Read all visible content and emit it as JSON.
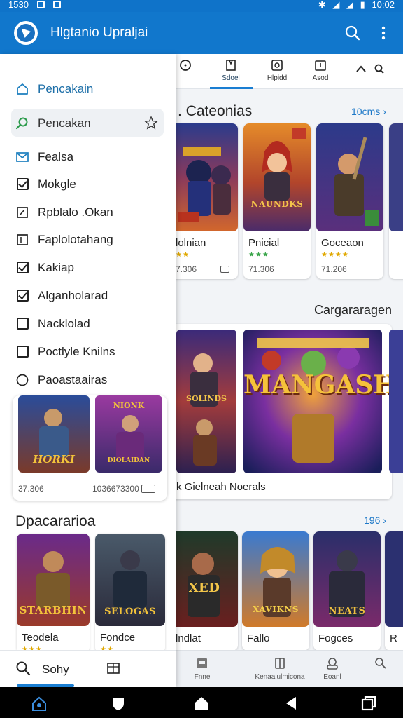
{
  "status_bar": {
    "time": "1530",
    "battery_time": "10:02"
  },
  "app_bar": {
    "title": "Hlgtanio Upraljai"
  },
  "tabs": [
    {
      "label": ""
    },
    {
      "label": "Sdoel"
    },
    {
      "label": "Hlpidd"
    },
    {
      "label": "Asod"
    },
    {
      "label": ""
    }
  ],
  "categories": {
    "title": "Cateonias",
    "see_all": "10cms",
    "cards": [
      {
        "name": "lolnian",
        "size": "7.306"
      },
      {
        "name": "Pnicial",
        "size": "71.306",
        "art_text": "NAUNDKS"
      },
      {
        "name": "Goceaon",
        "size": "71.206"
      },
      {
        "name": "",
        "size": ""
      }
    ]
  },
  "featured": {
    "title": "Cargararagen",
    "caption": "k Gielneah Noerals",
    "card_left_text": "SOLINDS",
    "card_main_text": "MANGASH"
  },
  "popular": {
    "title": "Dpacararioa",
    "see_all": "196",
    "cards": [
      {
        "name": "Teodela",
        "art_text": "STARBHIN"
      },
      {
        "name": "Fondce",
        "art_text": "SELOGAS"
      },
      {
        "name": "lndlat",
        "art_text": "XED"
      },
      {
        "name": "Fallo",
        "art_text": "XAVIKNS"
      },
      {
        "name": "Fogces",
        "art_text": "NEATS"
      },
      {
        "name": "R"
      }
    ]
  },
  "drawer": {
    "items": [
      {
        "label": "Pencakain",
        "icon": "home-icon"
      },
      {
        "label": "Pencakan",
        "icon": "search-icon"
      },
      {
        "label": "Fealsa",
        "icon": "mail-icon"
      },
      {
        "label": "Mokgle",
        "icon": "checkbox-icon",
        "checked": true
      },
      {
        "label": "Rpblalo .Okan",
        "icon": "edit-icon"
      },
      {
        "label": "Faplolotahang",
        "icon": "list-icon"
      },
      {
        "label": "Kakiap",
        "icon": "checkbox-icon",
        "checked": true
      },
      {
        "label": "Alganholarad",
        "icon": "checkbox-icon",
        "checked": true
      },
      {
        "label": "Nacklolad",
        "icon": "checkbox-icon",
        "checked": false
      },
      {
        "label": "Poctlyle Knilns",
        "icon": "checkbox-icon",
        "checked": false
      },
      {
        "label": "Paoastaairas",
        "icon": "circle-icon"
      }
    ],
    "card": {
      "left_text": "HORKI",
      "right_text": "DIOLAIDAN",
      "right_top_text": "NIONK",
      "left_size": "37.306",
      "right_size": "1036673300"
    },
    "bottom_label": "Sohy"
  },
  "bottom_bar": [
    {
      "label": "Fnne"
    },
    {
      "label": "Kenaalulmicona"
    },
    {
      "label": "Eoanl"
    },
    {
      "label": ""
    }
  ],
  "colors": {
    "primary": "#1177cc",
    "accent": "#1d78c8",
    "star": "#e0a800",
    "star_green": "#3aa54a"
  }
}
